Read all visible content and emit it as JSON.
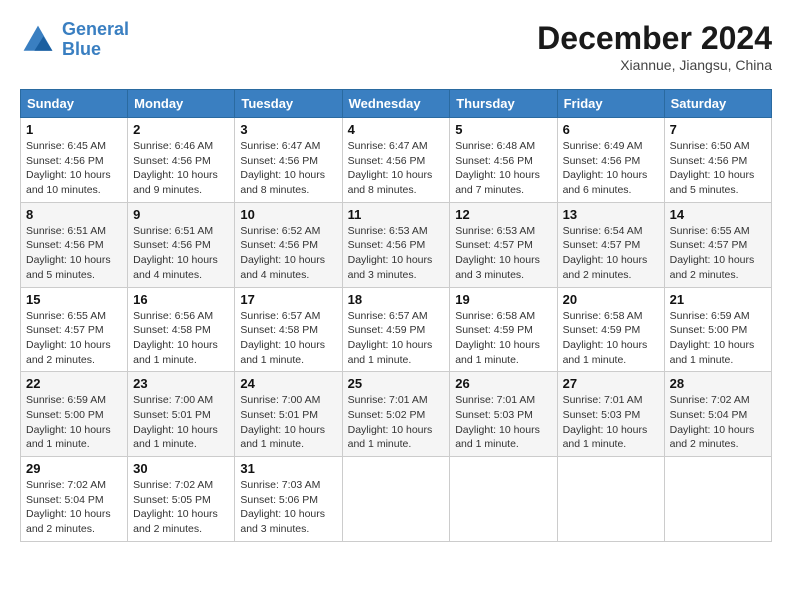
{
  "logo": {
    "line1": "General",
    "line2": "Blue"
  },
  "title": "December 2024",
  "subtitle": "Xiannue, Jiangsu, China",
  "weekdays": [
    "Sunday",
    "Monday",
    "Tuesday",
    "Wednesday",
    "Thursday",
    "Friday",
    "Saturday"
  ],
  "weeks": [
    [
      {
        "day": "1",
        "info": "Sunrise: 6:45 AM\nSunset: 4:56 PM\nDaylight: 10 hours\nand 10 minutes."
      },
      {
        "day": "2",
        "info": "Sunrise: 6:46 AM\nSunset: 4:56 PM\nDaylight: 10 hours\nand 9 minutes."
      },
      {
        "day": "3",
        "info": "Sunrise: 6:47 AM\nSunset: 4:56 PM\nDaylight: 10 hours\nand 8 minutes."
      },
      {
        "day": "4",
        "info": "Sunrise: 6:47 AM\nSunset: 4:56 PM\nDaylight: 10 hours\nand 8 minutes."
      },
      {
        "day": "5",
        "info": "Sunrise: 6:48 AM\nSunset: 4:56 PM\nDaylight: 10 hours\nand 7 minutes."
      },
      {
        "day": "6",
        "info": "Sunrise: 6:49 AM\nSunset: 4:56 PM\nDaylight: 10 hours\nand 6 minutes."
      },
      {
        "day": "7",
        "info": "Sunrise: 6:50 AM\nSunset: 4:56 PM\nDaylight: 10 hours\nand 5 minutes."
      }
    ],
    [
      {
        "day": "8",
        "info": "Sunrise: 6:51 AM\nSunset: 4:56 PM\nDaylight: 10 hours\nand 5 minutes."
      },
      {
        "day": "9",
        "info": "Sunrise: 6:51 AM\nSunset: 4:56 PM\nDaylight: 10 hours\nand 4 minutes."
      },
      {
        "day": "10",
        "info": "Sunrise: 6:52 AM\nSunset: 4:56 PM\nDaylight: 10 hours\nand 4 minutes."
      },
      {
        "day": "11",
        "info": "Sunrise: 6:53 AM\nSunset: 4:56 PM\nDaylight: 10 hours\nand 3 minutes."
      },
      {
        "day": "12",
        "info": "Sunrise: 6:53 AM\nSunset: 4:57 PM\nDaylight: 10 hours\nand 3 minutes."
      },
      {
        "day": "13",
        "info": "Sunrise: 6:54 AM\nSunset: 4:57 PM\nDaylight: 10 hours\nand 2 minutes."
      },
      {
        "day": "14",
        "info": "Sunrise: 6:55 AM\nSunset: 4:57 PM\nDaylight: 10 hours\nand 2 minutes."
      }
    ],
    [
      {
        "day": "15",
        "info": "Sunrise: 6:55 AM\nSunset: 4:57 PM\nDaylight: 10 hours\nand 2 minutes."
      },
      {
        "day": "16",
        "info": "Sunrise: 6:56 AM\nSunset: 4:58 PM\nDaylight: 10 hours\nand 1 minute."
      },
      {
        "day": "17",
        "info": "Sunrise: 6:57 AM\nSunset: 4:58 PM\nDaylight: 10 hours\nand 1 minute."
      },
      {
        "day": "18",
        "info": "Sunrise: 6:57 AM\nSunset: 4:59 PM\nDaylight: 10 hours\nand 1 minute."
      },
      {
        "day": "19",
        "info": "Sunrise: 6:58 AM\nSunset: 4:59 PM\nDaylight: 10 hours\nand 1 minute."
      },
      {
        "day": "20",
        "info": "Sunrise: 6:58 AM\nSunset: 4:59 PM\nDaylight: 10 hours\nand 1 minute."
      },
      {
        "day": "21",
        "info": "Sunrise: 6:59 AM\nSunset: 5:00 PM\nDaylight: 10 hours\nand 1 minute."
      }
    ],
    [
      {
        "day": "22",
        "info": "Sunrise: 6:59 AM\nSunset: 5:00 PM\nDaylight: 10 hours\nand 1 minute."
      },
      {
        "day": "23",
        "info": "Sunrise: 7:00 AM\nSunset: 5:01 PM\nDaylight: 10 hours\nand 1 minute."
      },
      {
        "day": "24",
        "info": "Sunrise: 7:00 AM\nSunset: 5:01 PM\nDaylight: 10 hours\nand 1 minute."
      },
      {
        "day": "25",
        "info": "Sunrise: 7:01 AM\nSunset: 5:02 PM\nDaylight: 10 hours\nand 1 minute."
      },
      {
        "day": "26",
        "info": "Sunrise: 7:01 AM\nSunset: 5:03 PM\nDaylight: 10 hours\nand 1 minute."
      },
      {
        "day": "27",
        "info": "Sunrise: 7:01 AM\nSunset: 5:03 PM\nDaylight: 10 hours\nand 1 minute."
      },
      {
        "day": "28",
        "info": "Sunrise: 7:02 AM\nSunset: 5:04 PM\nDaylight: 10 hours\nand 2 minutes."
      }
    ],
    [
      {
        "day": "29",
        "info": "Sunrise: 7:02 AM\nSunset: 5:04 PM\nDaylight: 10 hours\nand 2 minutes."
      },
      {
        "day": "30",
        "info": "Sunrise: 7:02 AM\nSunset: 5:05 PM\nDaylight: 10 hours\nand 2 minutes."
      },
      {
        "day": "31",
        "info": "Sunrise: 7:03 AM\nSunset: 5:06 PM\nDaylight: 10 hours\nand 3 minutes."
      },
      null,
      null,
      null,
      null
    ]
  ]
}
